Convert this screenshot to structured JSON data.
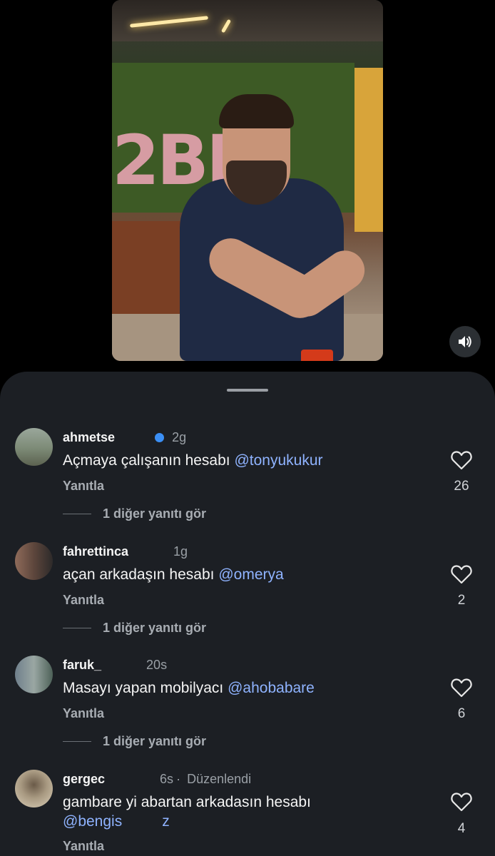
{
  "video": {
    "sign_text": "2BI"
  },
  "sound_button_icon": "speaker-icon",
  "comments": [
    {
      "username": "ahmetse",
      "time": "2g",
      "verified": true,
      "text": "Açmaya çalışanın hesabı ",
      "mention": "@tonyukukur",
      "reply_label": "Yanıtla",
      "likes": "26",
      "more_replies": "1 diğer yanıtı gör"
    },
    {
      "username": "fahrettinca",
      "time": "1g",
      "text": "açan arkadaşın hesabı ",
      "mention": "@omerya",
      "reply_label": "Yanıtla",
      "likes": "2",
      "more_replies": "1 diğer yanıtı gör"
    },
    {
      "username": "faruk_",
      "time": "20s",
      "text": "Masayı yapan mobilyacı ",
      "mention": "@ahobabare",
      "reply_label": "Yanıtla",
      "likes": "6",
      "more_replies": "1 diğer yanıtı gör"
    },
    {
      "username": "gergec",
      "time": "6s",
      "edited": "Düzenlendi",
      "text": "gambare yi abartan arkadasın hesabı",
      "mention": "@bengis",
      "mention_tail": "z",
      "reply_label": "Yanıtla",
      "likes": "4"
    }
  ]
}
